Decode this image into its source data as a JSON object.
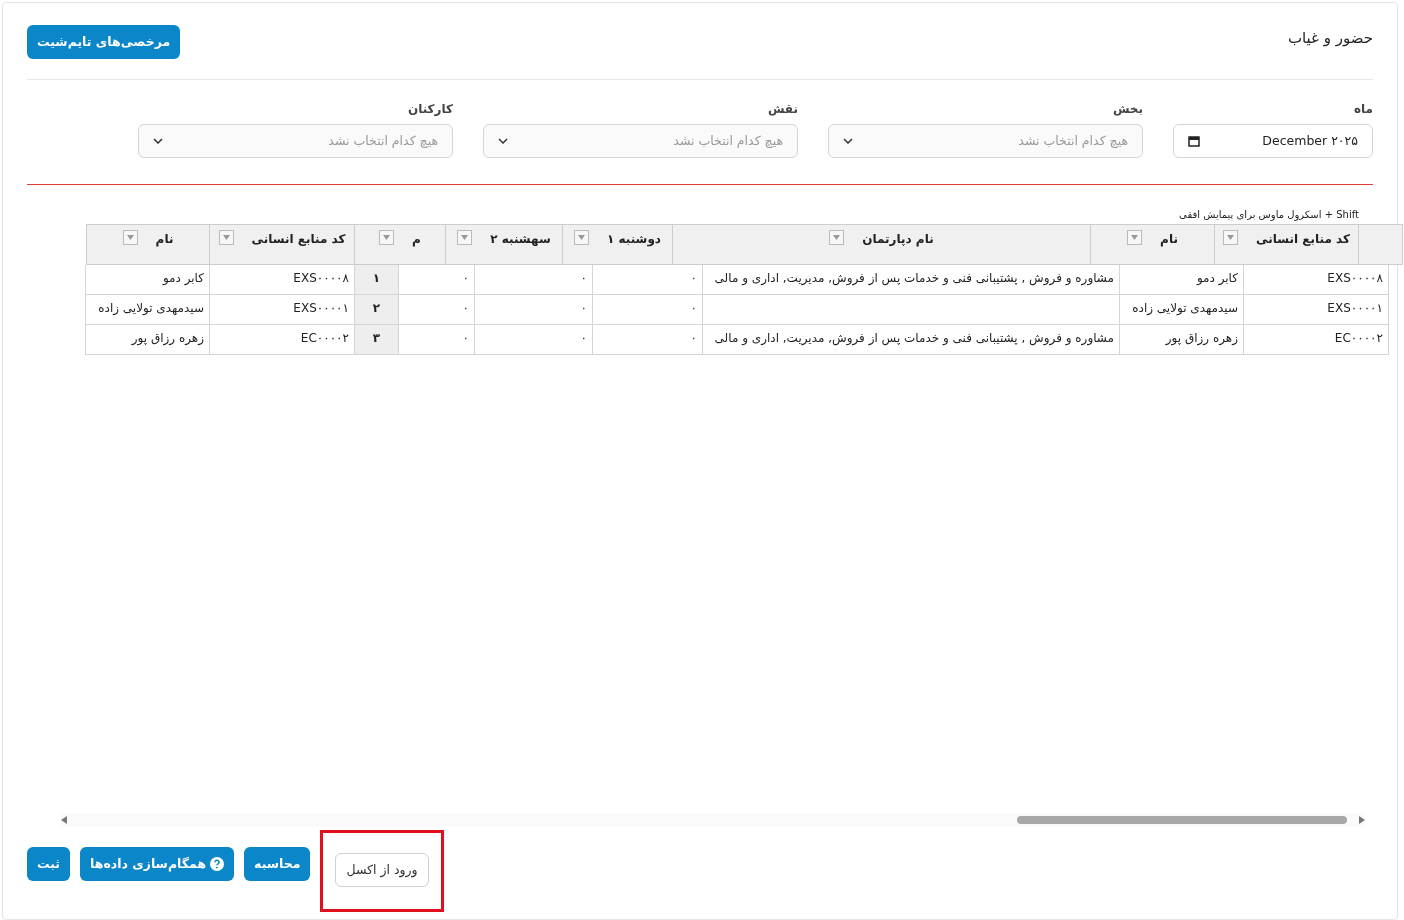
{
  "page": {
    "title": "حضور و غیاب",
    "header_button": "مرخصی‌های تایم‌شیت"
  },
  "filters": [
    {
      "label": "ماه",
      "kind": "month",
      "value": "December ۲۰۲۵"
    },
    {
      "label": "بخش",
      "kind": "select",
      "placeholder": "هیچ کدام انتخاب نشد"
    },
    {
      "label": "نقش",
      "kind": "select",
      "placeholder": "هیچ کدام انتخاب نشد"
    },
    {
      "label": "کارکنان",
      "kind": "select",
      "placeholder": "هیچ کدام انتخاب نشد"
    }
  ],
  "scroll_hint": "Shift + اسکرول ماوس برای پیمایش افقی",
  "table": {
    "columns": [
      "کد منابع انسانی",
      "نام",
      "نام دپارتمان",
      "دوشنبه ۱",
      "سهشنبه ۲",
      "م",
      "کد منابع انسانی",
      "نام"
    ],
    "rows": [
      {
        "hr_code": "EXS۰۰۰۰۸",
        "name": "کابر دمو",
        "department": "مشاوره و فروش , پشتیبانی فنی و خدمات پس از فروش, مدیریت, اداری و مالی",
        "values": [
          "۰",
          "۰",
          "۰"
        ],
        "number": "۱",
        "frozen_hr_code": "EXS۰۰۰۰۸",
        "frozen_name": "کابر دمو"
      },
      {
        "hr_code": "EXS۰۰۰۰۱",
        "name": "سیدمهدی تولایی زاده",
        "values": [
          "۰",
          "۰",
          "۰"
        ],
        "number": "۲",
        "frozen_hr_code": "EXS۰۰۰۰۱",
        "frozen_name": "سیدمهدی تولایی زاده"
      },
      {
        "hr_code": "EC۰۰۰۰۲",
        "name": "زهره رزاق پور",
        "department": "مشاوره و فروش , پشتیبانی فنی و خدمات پس از فروش, مدیریت, اداری و مالی",
        "values": [
          "۰",
          "۰",
          "۰"
        ],
        "number": "۳",
        "frozen_hr_code": "EC۰۰۰۰۲",
        "frozen_name": "زهره رزاق پور"
      }
    ]
  },
  "buttons": [
    {
      "label": "ورود از اکسل",
      "kind": "outline",
      "highlighted": true
    },
    {
      "label": "محاسبه",
      "kind": "primary",
      "highlighted": false
    },
    {
      "label": "همگام‌سازی داده‌ها",
      "kind": "primary",
      "help": true,
      "highlighted": false
    },
    {
      "label": "ثبت",
      "kind": "primary",
      "highlighted": false
    }
  ]
}
